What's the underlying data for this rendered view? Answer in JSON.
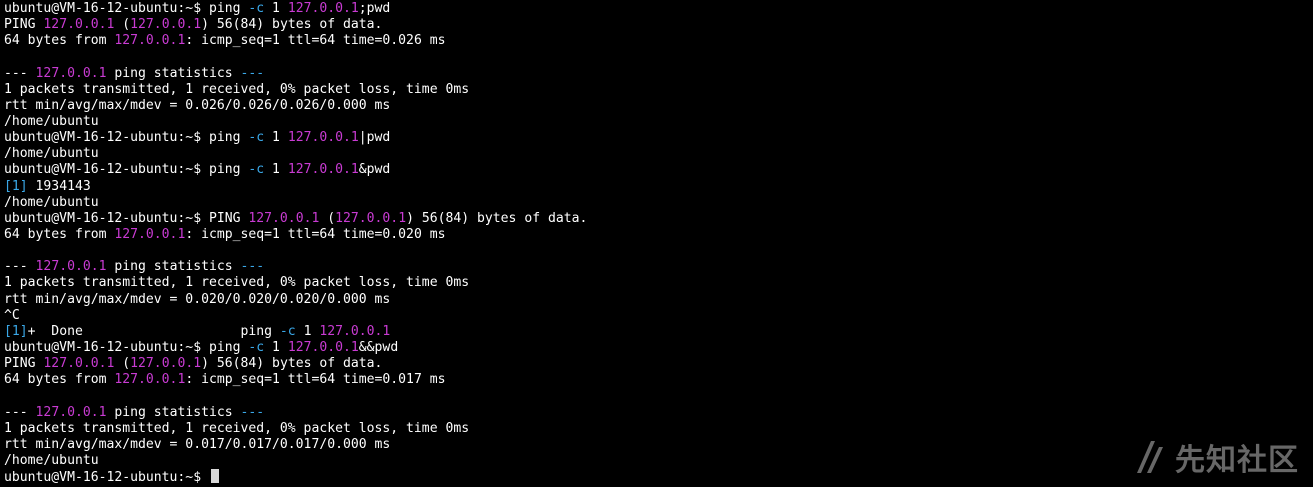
{
  "colors": {
    "default": "#ffffff",
    "ip": "#c93bd3",
    "flag": "#3aa8e8",
    "cursor": "#d8d8d8"
  },
  "terminal": {
    "lines": [
      [
        {
          "t": "ubuntu@VM-16-12-ubuntu:~$ ping "
        },
        {
          "t": "-c",
          "c": "flag"
        },
        {
          "t": " 1 "
        },
        {
          "t": "127.0.0.1",
          "c": "ip"
        },
        {
          "t": ";pwd"
        }
      ],
      [
        {
          "t": "PING "
        },
        {
          "t": "127.0.0.1",
          "c": "ip"
        },
        {
          "t": " ("
        },
        {
          "t": "127.0.0.1",
          "c": "ip"
        },
        {
          "t": ") 56(84) bytes of data."
        }
      ],
      [
        {
          "t": "64 bytes from "
        },
        {
          "t": "127.0.0.1",
          "c": "ip"
        },
        {
          "t": ": icmp_seq=1 ttl=64 time=0.026 ms"
        }
      ],
      [],
      [
        {
          "t": "--- "
        },
        {
          "t": "127.0.0.1",
          "c": "ip"
        },
        {
          "t": " ping statistics "
        },
        {
          "t": "---",
          "c": "flag"
        }
      ],
      [
        {
          "t": "1 packets transmitted, 1 received, 0% packet loss, time 0ms"
        }
      ],
      [
        {
          "t": "rtt min/avg/max/mdev = 0.026/0.026/0.026/0.000 ms"
        }
      ],
      [
        {
          "t": "/home/ubuntu"
        }
      ],
      [
        {
          "t": "ubuntu@VM-16-12-ubuntu:~$ ping "
        },
        {
          "t": "-c",
          "c": "flag"
        },
        {
          "t": " 1 "
        },
        {
          "t": "127.0.0.1",
          "c": "ip"
        },
        {
          "t": "|pwd"
        }
      ],
      [
        {
          "t": "/home/ubuntu"
        }
      ],
      [
        {
          "t": "ubuntu@VM-16-12-ubuntu:~$ ping "
        },
        {
          "t": "-c",
          "c": "flag"
        },
        {
          "t": " 1 "
        },
        {
          "t": "127.0.0.1",
          "c": "ip"
        },
        {
          "t": "&pwd"
        }
      ],
      [
        {
          "t": "[1]",
          "c": "flag"
        },
        {
          "t": " 1934143"
        }
      ],
      [
        {
          "t": "/home/ubuntu"
        }
      ],
      [
        {
          "t": "ubuntu@VM-16-12-ubuntu:~$ PING "
        },
        {
          "t": "127.0.0.1",
          "c": "ip"
        },
        {
          "t": " ("
        },
        {
          "t": "127.0.0.1",
          "c": "ip"
        },
        {
          "t": ") 56(84) bytes of data."
        }
      ],
      [
        {
          "t": "64 bytes from "
        },
        {
          "t": "127.0.0.1",
          "c": "ip"
        },
        {
          "t": ": icmp_seq=1 ttl=64 time=0.020 ms"
        }
      ],
      [],
      [
        {
          "t": "--- "
        },
        {
          "t": "127.0.0.1",
          "c": "ip"
        },
        {
          "t": " ping statistics "
        },
        {
          "t": "---",
          "c": "flag"
        }
      ],
      [
        {
          "t": "1 packets transmitted, 1 received, 0% packet loss, time 0ms"
        }
      ],
      [
        {
          "t": "rtt min/avg/max/mdev = 0.020/0.020/0.020/0.000 ms"
        }
      ],
      [
        {
          "t": "^C"
        }
      ],
      [
        {
          "t": "[1]",
          "c": "flag"
        },
        {
          "t": "+  Done                    ping "
        },
        {
          "t": "-c",
          "c": "flag"
        },
        {
          "t": " 1 "
        },
        {
          "t": "127.0.0.1",
          "c": "ip"
        }
      ],
      [
        {
          "t": "ubuntu@VM-16-12-ubuntu:~$ ping "
        },
        {
          "t": "-c",
          "c": "flag"
        },
        {
          "t": " 1 "
        },
        {
          "t": "127.0.0.1",
          "c": "ip"
        },
        {
          "t": "&&pwd"
        }
      ],
      [
        {
          "t": "PING "
        },
        {
          "t": "127.0.0.1",
          "c": "ip"
        },
        {
          "t": " ("
        },
        {
          "t": "127.0.0.1",
          "c": "ip"
        },
        {
          "t": ") 56(84) bytes of data."
        }
      ],
      [
        {
          "t": "64 bytes from "
        },
        {
          "t": "127.0.0.1",
          "c": "ip"
        },
        {
          "t": ": icmp_seq=1 ttl=64 time=0.017 ms"
        }
      ],
      [],
      [
        {
          "t": "--- "
        },
        {
          "t": "127.0.0.1",
          "c": "ip"
        },
        {
          "t": " ping statistics "
        },
        {
          "t": "---",
          "c": "flag"
        }
      ],
      [
        {
          "t": "1 packets transmitted, 1 received, 0% packet loss, time 0ms"
        }
      ],
      [
        {
          "t": "rtt min/avg/max/mdev = 0.017/0.017/0.017/0.000 ms"
        }
      ],
      [
        {
          "t": "/home/ubuntu"
        }
      ],
      [
        {
          "t": "ubuntu@VM-16-12-ubuntu:~$ "
        }
      ]
    ],
    "cursor_line": 29
  },
  "watermark": {
    "text": "先知社区",
    "icon": "xianzhi-logo-icon"
  }
}
